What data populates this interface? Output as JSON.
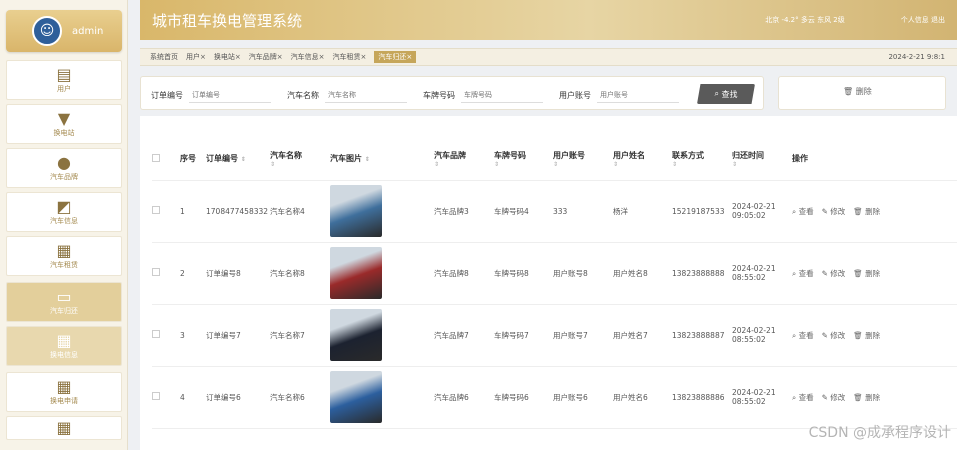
{
  "sidebar": {
    "username": "admin",
    "items": [
      {
        "label": "用户",
        "icon": "briefcase-icon"
      },
      {
        "label": "换电站",
        "icon": "signpost-icon"
      },
      {
        "label": "汽车品牌",
        "icon": "person-icon"
      },
      {
        "label": "汽车信息",
        "icon": "chart-icon"
      },
      {
        "label": "汽车租赁",
        "icon": "grid-icon"
      },
      {
        "label": "汽车归还",
        "icon": "laptop-icon"
      },
      {
        "label": "换电信息",
        "icon": "grid-icon"
      },
      {
        "label": "换电申请",
        "icon": "grid-icon"
      }
    ]
  },
  "header": {
    "title": "城市租车换电管理系统",
    "weather": "北京 -4.2° 多云 东风 2级",
    "profile_link": "个人信息",
    "logout_link": "退出"
  },
  "tabs": {
    "items": [
      "系统首页",
      "用户×",
      "换电站×",
      "汽车品牌×",
      "汽车信息×",
      "汽车租赁×",
      "汽车归还×"
    ],
    "active_index": 6,
    "datetime": "2024-2-21 9:8:1"
  },
  "search": {
    "order_label": "订单编号",
    "order_placeholder": "订单编号",
    "car_label": "汽车名称",
    "car_placeholder": "汽车名称",
    "plate_label": "车牌号码",
    "plate_placeholder": "车牌号码",
    "account_label": "用户账号",
    "account_placeholder": "用户账号",
    "button": "查找",
    "delete_button": "删除"
  },
  "table": {
    "headers": [
      "序号",
      "订单编号",
      "汽车名称",
      "汽车图片",
      "汽车品牌",
      "车牌号码",
      "用户账号",
      "用户姓名",
      "联系方式",
      "归还时间",
      "操作"
    ],
    "rows": [
      {
        "no": "1",
        "order": "1708477458332",
        "car": "汽车名称4",
        "brand": "汽车品牌3",
        "plate": "车牌号码4",
        "account": "333",
        "name": "杨洋",
        "phone": "15219187533",
        "time": "2024-02-21 09:05:02",
        "img_color": "#3f6f9c"
      },
      {
        "no": "2",
        "order": "订单编号8",
        "car": "汽车名称8",
        "brand": "汽车品牌8",
        "plate": "车牌号码8",
        "account": "用户账号8",
        "name": "用户姓名8",
        "phone": "13823888888",
        "time": "2024-02-21 08:55:02",
        "img_color": "#9a2a2a"
      },
      {
        "no": "3",
        "order": "订单编号7",
        "car": "汽车名称7",
        "brand": "汽车品牌7",
        "plate": "车牌号码7",
        "account": "用户账号7",
        "name": "用户姓名7",
        "phone": "13823888887",
        "time": "2024-02-21 08:55:02",
        "img_color": "#1c2230"
      },
      {
        "no": "4",
        "order": "订单编号6",
        "car": "汽车名称6",
        "brand": "汽车品牌6",
        "plate": "车牌号码6",
        "account": "用户账号6",
        "name": "用户姓名6",
        "phone": "13823888886",
        "time": "2024-02-21 08:55:02",
        "img_color": "#2c5f9e"
      }
    ],
    "ops": {
      "view": "查看",
      "edit": "修改",
      "delete": "删除"
    }
  },
  "watermark": "CSDN @成承程序设计"
}
